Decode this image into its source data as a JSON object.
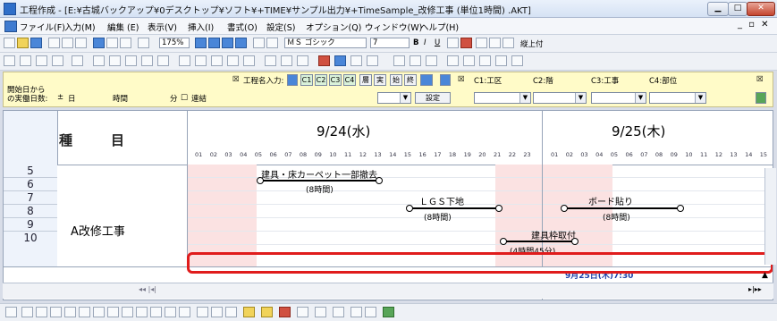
{
  "window": {
    "title": "工程作成 - [E:¥古城バックアップ¥0デスクトップ¥ソフト¥+TIME¥サンプル出力¥+TimeSample_改修工事 (単位1時間) .AKT]"
  },
  "menu": [
    "ファイル(F)",
    "入力(M)",
    "編集 (E)",
    "表示(V)",
    "挿入(I)",
    "書式(O)",
    "設定(S)",
    "オプション(Q)",
    "ウィンドウ(W)",
    "ヘルプ(H)"
  ],
  "toolbar1": {
    "zoom": "175%",
    "font": "ＭＳ ゴシック",
    "size": "7",
    "format_label": "縦上付"
  },
  "process_bar": {
    "start_label_1": "開始日から",
    "start_label_2": "の実働日数:",
    "day_unit": "日",
    "time_unit": "時間",
    "minute_unit": "分",
    "continue_label": "連結",
    "name_input_label": "工程名入力:",
    "setting_button": "設定",
    "c1_label": "C1:工区",
    "c2_label": "C2:階",
    "c3_label": "C3:工事",
    "c4_label": "C4:部位",
    "buttons": [
      "C1",
      "C2",
      "C3",
      "C4",
      "層",
      "実",
      "始",
      "終"
    ]
  },
  "gantt": {
    "kind_header": "種　目",
    "days": [
      {
        "label": "9/24(水)"
      },
      {
        "label": "9/25(木)"
      }
    ],
    "hours_day1": [
      "01",
      "02",
      "03",
      "04",
      "05",
      "06",
      "07",
      "08",
      "09",
      "10",
      "11",
      "12",
      "13",
      "14",
      "15",
      "16",
      "17",
      "18",
      "19",
      "20",
      "21",
      "22",
      "23"
    ],
    "hours_day2": [
      "01",
      "02",
      "03",
      "04",
      "05",
      "06",
      "07",
      "08",
      "09",
      "10",
      "11",
      "12",
      "13",
      "14",
      "15"
    ],
    "row_numbers": [
      "5",
      "6",
      "7",
      "8",
      "9",
      "10"
    ],
    "group_name": "A改修工事",
    "tasks": [
      {
        "name": "建具・床カーペット一部撤去",
        "duration": "(8時間)"
      },
      {
        "name": "ＬＧＳ下地",
        "duration": "(8時間)"
      },
      {
        "name": "ボード貼り",
        "duration": "(8時間)"
      },
      {
        "name": "建具枠取付",
        "duration": "(4時間45分)"
      }
    ],
    "status_datetime": "9月25日(木)7:30"
  },
  "colors": {
    "highlight": "#e01c1c",
    "offhours_shade": "#fbe2e2",
    "process_bar_bg": "#fffbc8"
  }
}
